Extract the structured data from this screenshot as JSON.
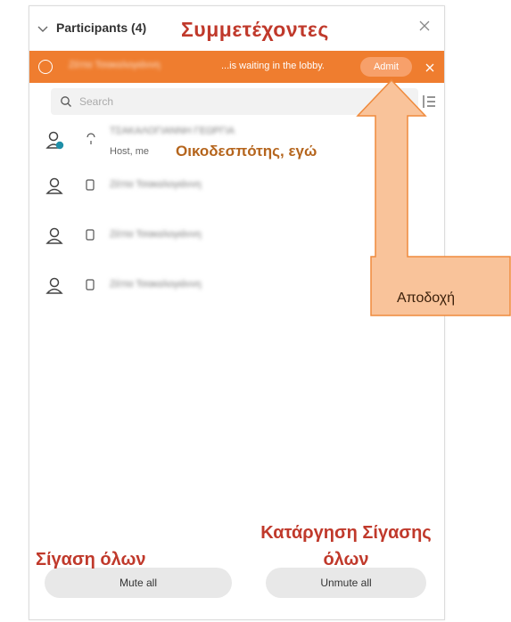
{
  "header": {
    "title": "Participants (4)"
  },
  "annotations": {
    "title": "Συμμετέχοντες",
    "host": "Οικοδεσπότης, εγώ",
    "admit": "Αποδοχή",
    "mute_all": "Σίγαση όλων",
    "unmute_all": "Κατάργηση Σίγασης όλων"
  },
  "lobby": {
    "name": "Ζέττα Τσακαλογιάννη",
    "message": "...is waiting in the lobby.",
    "admit_label": "Admit"
  },
  "search": {
    "placeholder": "Search"
  },
  "participants": [
    {
      "name": "ΤΣΑΚΑΛΟΓΙΑΝΝΗ ΓΕΩΡΓΙΑ",
      "role": "Host, me"
    },
    {
      "name": "Ζέττα Τσακαλογιάννη",
      "role": ""
    },
    {
      "name": "Ζέττα Τσακαλογιάννη",
      "role": ""
    },
    {
      "name": "Ζέττα Τσακαλογιάννη",
      "role": ""
    }
  ],
  "footer": {
    "mute_all_label": "Mute all",
    "unmute_all_label": "Unmute all"
  },
  "colors": {
    "lobby_bg": "#ef7d2f",
    "annotation_red": "#c0392b",
    "annotation_orange": "#b5651d",
    "arrow_fill": "#f9c39a",
    "arrow_stroke": "#ef8a3c"
  }
}
